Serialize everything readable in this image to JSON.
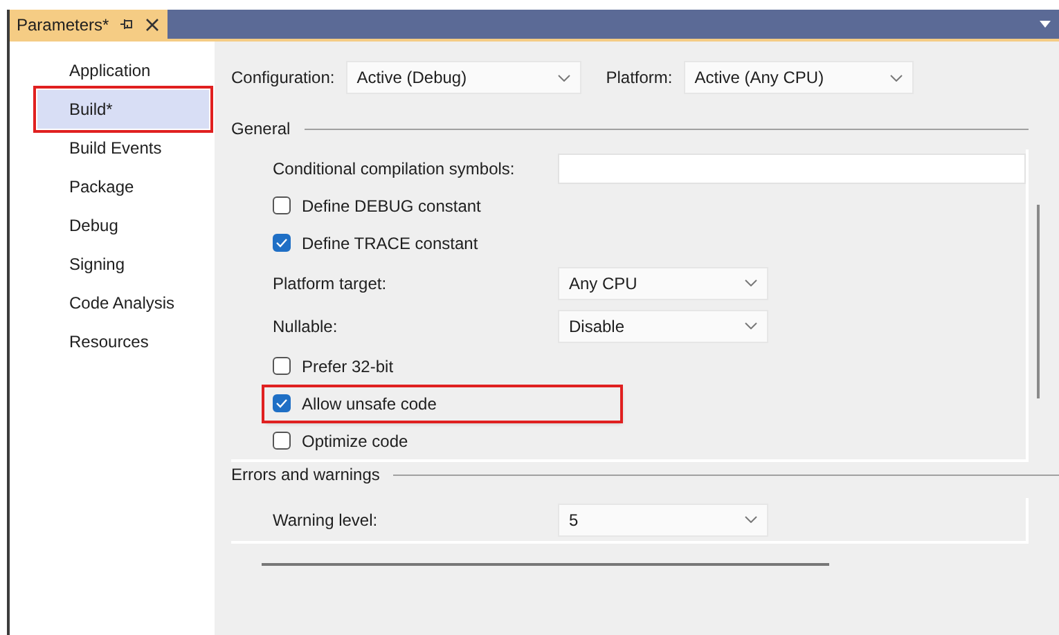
{
  "tab": {
    "title": "Parameters*"
  },
  "sidebar": {
    "items": [
      {
        "label": "Application",
        "selected": false,
        "highlighted": false
      },
      {
        "label": "Build*",
        "selected": true,
        "highlighted": true
      },
      {
        "label": "Build Events",
        "selected": false,
        "highlighted": false
      },
      {
        "label": "Package",
        "selected": false,
        "highlighted": false
      },
      {
        "label": "Debug",
        "selected": false,
        "highlighted": false
      },
      {
        "label": "Signing",
        "selected": false,
        "highlighted": false
      },
      {
        "label": "Code Analysis",
        "selected": false,
        "highlighted": false
      },
      {
        "label": "Resources",
        "selected": false,
        "highlighted": false
      }
    ]
  },
  "toolbar": [
    {
      "label": "Configuration:",
      "value": "Active (Debug)"
    },
    {
      "label": "Platform:",
      "value": "Active (Any CPU)"
    }
  ],
  "sections": [
    {
      "title": "General",
      "items": [
        {
          "kind": "textbox",
          "label": "Conditional compilation symbols:"
        },
        {
          "kind": "checkbox",
          "label": "Define DEBUG constant",
          "checked": false,
          "highlighted": false
        },
        {
          "kind": "checkbox",
          "label": "Define TRACE constant",
          "checked": true,
          "highlighted": false
        },
        {
          "kind": "dropdown",
          "label": "Platform target:",
          "value": "Any CPU"
        },
        {
          "kind": "dropdown",
          "label": "Nullable:",
          "value": "Disable"
        },
        {
          "kind": "checkbox",
          "label": "Prefer 32-bit",
          "checked": false,
          "highlighted": false
        },
        {
          "kind": "checkbox",
          "label": "Allow unsafe code",
          "checked": true,
          "highlighted": true
        },
        {
          "kind": "checkbox",
          "label": "Optimize code",
          "checked": false,
          "highlighted": false
        }
      ]
    },
    {
      "title": "Errors and warnings",
      "items": [
        {
          "kind": "dropdown",
          "label": "Warning level:",
          "value": "5"
        }
      ]
    }
  ]
}
